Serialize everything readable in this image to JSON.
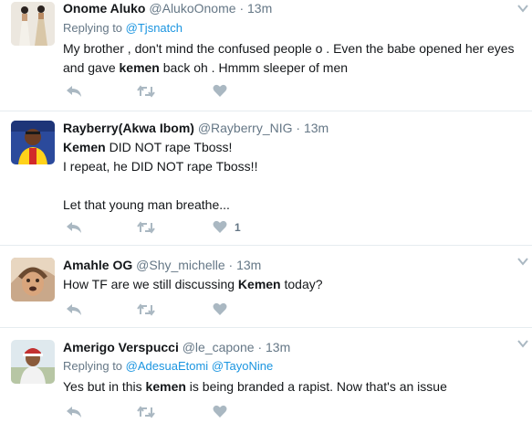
{
  "tweets": [
    {
      "name": "Onome Aluko",
      "handle": "@AlukoOnome",
      "dot": "·",
      "time": "13m",
      "replying_label": "Replying to",
      "replying_to": [
        "@Tjsnatch"
      ],
      "text_parts": [
        "My brother , don't mind the confused people o . Even the babe opened her eyes and gave ",
        "kemen",
        " back oh . Hmmm sleeper of men"
      ],
      "like_count": ""
    },
    {
      "name": "Rayberry(Akwa Ibom)",
      "handle": "@Rayberry_NIG",
      "dot": "·",
      "time": "13m",
      "lines": [
        {
          "bold": "Kemen",
          "rest": " DID NOT rape Tboss!"
        },
        {
          "bold": "",
          "rest": "I repeat, he DID NOT rape Tboss!!"
        },
        {
          "bold": "",
          "rest": ""
        },
        {
          "bold": "",
          "rest": "Let that young man breathe..."
        }
      ],
      "like_count": "1"
    },
    {
      "name": "Amahle OG",
      "handle": "@Shy_michelle",
      "dot": "·",
      "time": "13m",
      "text_parts": [
        "How TF are we still discussing ",
        "Kemen",
        " today?"
      ],
      "like_count": ""
    },
    {
      "name": "Amerigo Verspucci",
      "handle": "@le_capone",
      "dot": "·",
      "time": "13m",
      "replying_label": "Replying to",
      "replying_to": [
        "@AdesuaEtomi",
        "@TayoNine"
      ],
      "text_parts": [
        "Yes but in this ",
        "kemen",
        " is being branded a rapist. Now that's an issue"
      ],
      "like_count": ""
    }
  ],
  "colors": {
    "text": "#14171a",
    "muted": "#657786",
    "link": "#1b95e0",
    "icon": "#aab8c2",
    "divider": "#e6ecf0"
  },
  "icons": [
    "reply-icon",
    "retweet-icon",
    "like-icon",
    "caret-down-icon"
  ]
}
